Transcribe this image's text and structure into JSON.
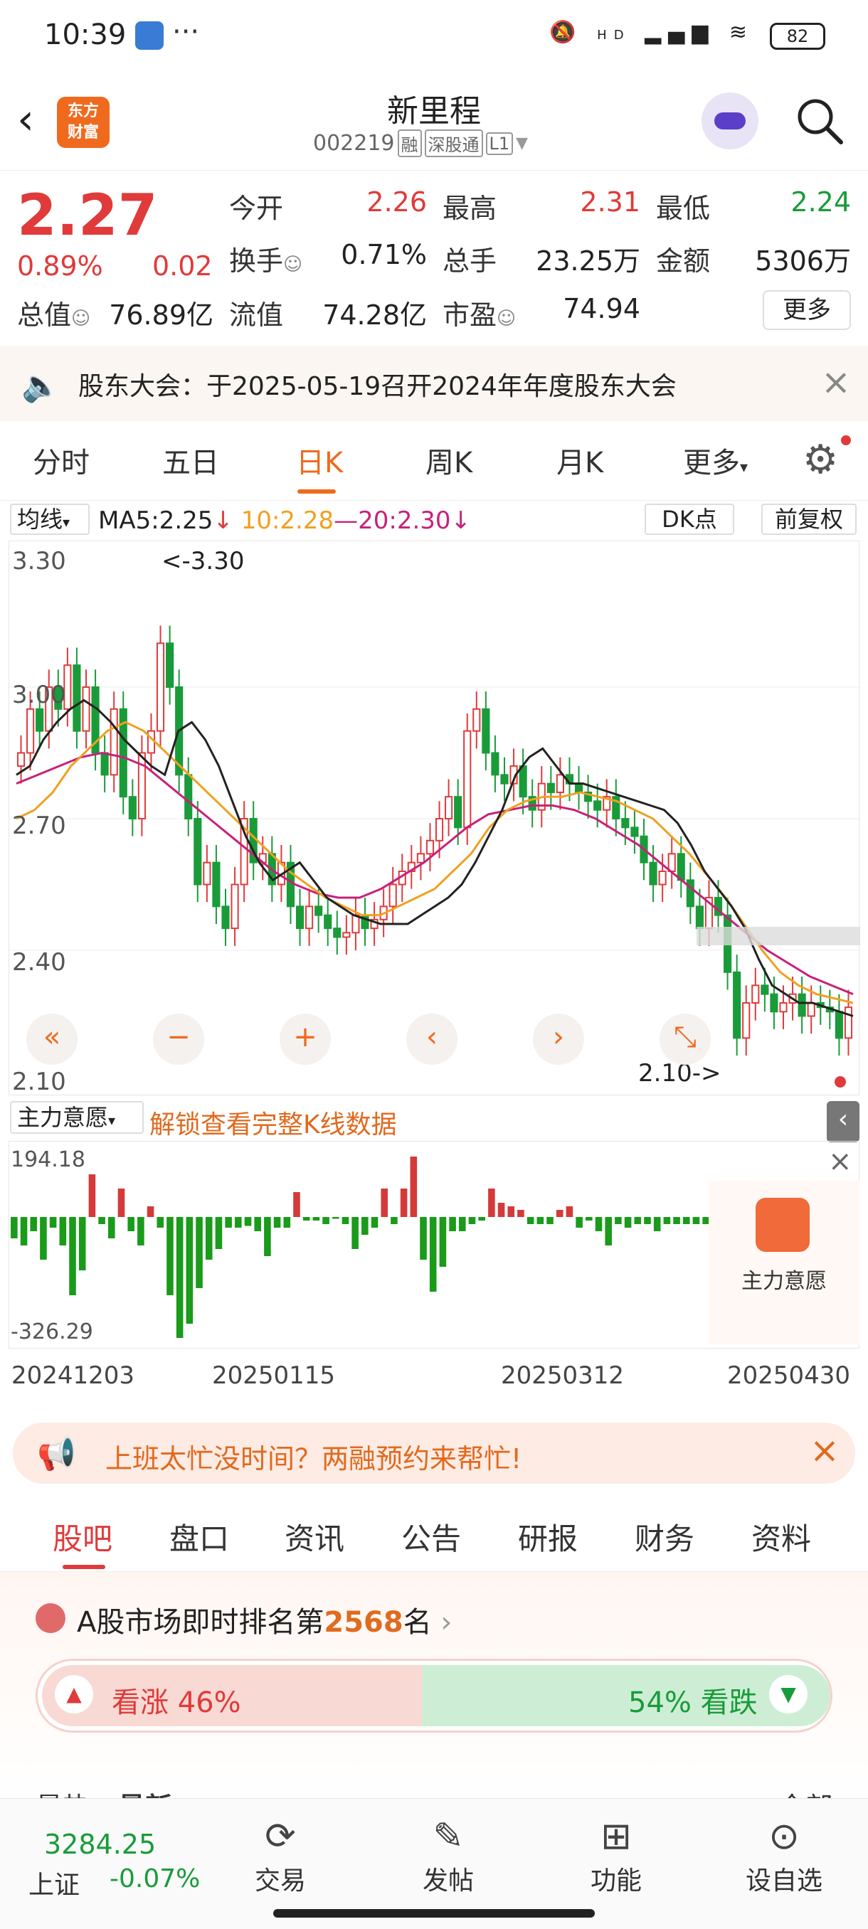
{
  "status_bar": {
    "time": "10:39",
    "extra": "···",
    "battery": "82",
    "signal_text": "HD"
  },
  "header": {
    "title": "新里程",
    "code": "002219",
    "tags": [
      "融",
      "深股通",
      "L1"
    ],
    "logo_text_1": "东方",
    "logo_text_2": "财富"
  },
  "quote": {
    "price": "2.27",
    "change_pct": "0.89%",
    "change": "0.02",
    "rows": [
      [
        {
          "label": "今开",
          "value": "2.26",
          "tone": "red"
        },
        {
          "label": "最高",
          "value": "2.31",
          "tone": "red"
        },
        {
          "label": "最低",
          "value": "2.24",
          "tone": "green"
        }
      ],
      [
        {
          "label": "换手",
          "value": "0.71%",
          "tone": "plain"
        },
        {
          "label": "总手",
          "value": "23.25万",
          "tone": "plain"
        },
        {
          "label": "金额",
          "value": "5306万",
          "tone": "plain"
        }
      ],
      [
        {
          "label": "总值",
          "value": "76.89亿",
          "tone": "plain"
        },
        {
          "label": "流值",
          "value": "74.28亿",
          "tone": "plain"
        },
        {
          "label": "市盈",
          "value": "74.94",
          "tone": "plain"
        }
      ]
    ],
    "more_label": "更多"
  },
  "notice": {
    "text": "股东大会：于2025-05-19召开2024年年度股东大会"
  },
  "period_tabs": [
    "分时",
    "五日",
    "日K",
    "周K",
    "月K",
    "更多"
  ],
  "active_period": "日K",
  "ma_row": {
    "selector": "均线",
    "ma5": "MA5:2.25",
    "ma10": "10:2.28",
    "ma20": "20:2.30",
    "dk_label": "DK点",
    "adjust_label": "前复权",
    "colors": {
      "ma5": "#222222",
      "ma10": "#f0a020",
      "ma20": "#c8207a",
      "up": "#e03a3a",
      "down": "#1a9b3a"
    }
  },
  "chart_data": {
    "type": "candlestick",
    "y_ticks": [
      "3.30",
      "3.00",
      "2.70",
      "2.40",
      "2.10"
    ],
    "ylim": [
      2.1,
      3.3
    ],
    "max_marker": "<-3.30",
    "min_marker": "2.10->",
    "x_labels": [
      "20241203",
      "20250115",
      "20250312",
      "20250430"
    ],
    "close": [
      2.85,
      2.95,
      2.9,
      3.0,
      2.95,
      3.05,
      2.9,
      3.0,
      2.85,
      2.8,
      2.95,
      2.75,
      2.7,
      2.85,
      2.9,
      3.1,
      3.0,
      2.8,
      2.7,
      2.55,
      2.6,
      2.5,
      2.45,
      2.55,
      2.7,
      2.6,
      2.62,
      2.55,
      2.6,
      2.5,
      2.45,
      2.5,
      2.48,
      2.45,
      2.43,
      2.44,
      2.48,
      2.45,
      2.47,
      2.5,
      2.55,
      2.58,
      2.6,
      2.62,
      2.65,
      2.7,
      2.75,
      2.68,
      2.9,
      2.95,
      2.85,
      2.8,
      2.78,
      2.82,
      2.75,
      2.72,
      2.78,
      2.76,
      2.8,
      2.78,
      2.76,
      2.74,
      2.72,
      2.75,
      2.7,
      2.68,
      2.66,
      2.6,
      2.55,
      2.58,
      2.62,
      2.56,
      2.5,
      2.45,
      2.52,
      2.48,
      2.35,
      2.2,
      2.28,
      2.32,
      2.3,
      2.26,
      2.28,
      2.3,
      2.25,
      2.28,
      2.27,
      2.26,
      2.2,
      2.27
    ],
    "ma5": [
      2.8,
      2.82,
      2.88,
      2.92,
      2.95,
      2.97,
      2.95,
      2.92,
      2.88,
      2.85,
      2.82,
      2.8,
      2.9,
      2.92,
      2.88,
      2.82,
      2.74,
      2.66,
      2.6,
      2.56,
      2.58,
      2.6,
      2.56,
      2.52,
      2.5,
      2.48,
      2.47,
      2.46,
      2.46,
      2.46,
      2.48,
      2.5,
      2.52,
      2.55,
      2.6,
      2.66,
      2.72,
      2.8,
      2.84,
      2.86,
      2.82,
      2.78,
      2.78,
      2.77,
      2.76,
      2.75,
      2.74,
      2.73,
      2.72,
      2.69,
      2.64,
      2.58,
      2.54,
      2.5,
      2.45,
      2.38,
      2.32,
      2.3,
      2.28,
      2.28,
      2.27,
      2.26,
      2.25
    ],
    "ma10": [
      2.7,
      2.72,
      2.76,
      2.82,
      2.86,
      2.9,
      2.92,
      2.9,
      2.86,
      2.82,
      2.78,
      2.74,
      2.7,
      2.66,
      2.62,
      2.58,
      2.55,
      2.52,
      2.5,
      2.48,
      2.48,
      2.5,
      2.52,
      2.54,
      2.58,
      2.62,
      2.68,
      2.72,
      2.74,
      2.75,
      2.75,
      2.76,
      2.75,
      2.74,
      2.72,
      2.7,
      2.66,
      2.62,
      2.57,
      2.52,
      2.46,
      2.4,
      2.35,
      2.32,
      2.3,
      2.29,
      2.28
    ],
    "ma20": [
      2.78,
      2.8,
      2.82,
      2.84,
      2.85,
      2.84,
      2.82,
      2.78,
      2.74,
      2.7,
      2.66,
      2.62,
      2.58,
      2.55,
      2.53,
      2.52,
      2.52,
      2.54,
      2.57,
      2.6,
      2.64,
      2.68,
      2.71,
      2.72,
      2.73,
      2.73,
      2.72,
      2.7,
      2.67,
      2.64,
      2.6,
      2.56,
      2.52,
      2.48,
      2.44,
      2.4,
      2.37,
      2.34,
      2.32,
      2.3
    ]
  },
  "chart_nav": [
    "«",
    "−",
    "+",
    "‹",
    "›",
    "⤡"
  ],
  "indicator": {
    "selector": "主力意愿",
    "unlock_text": "解锁查看完整K线数据",
    "max_label": "194.18",
    "min_label": "-326.29",
    "overlay_label": "主力意愿",
    "values": [
      -60,
      -80,
      -40,
      -120,
      -30,
      -80,
      -220,
      -150,
      120,
      -20,
      -60,
      80,
      -40,
      -80,
      30,
      -30,
      -220,
      -340,
      -300,
      -200,
      -120,
      -90,
      -30,
      -30,
      -25,
      -40,
      -110,
      -30,
      -30,
      70,
      -10,
      -10,
      -20,
      -5,
      -20,
      -90,
      -50,
      -30,
      80,
      -20,
      80,
      170,
      -120,
      -210,
      -140,
      -40,
      -40,
      -20,
      -10,
      80,
      40,
      30,
      20,
      -20,
      -20,
      -20,
      20,
      30,
      -30,
      -10,
      -40,
      -80,
      -20,
      -30,
      -20,
      -20,
      -40,
      -20,
      -20,
      -20,
      -20,
      -20
    ]
  },
  "banner": {
    "text": "上班太忙没时间？两融预约来帮忙!"
  },
  "content_tabs": [
    "股吧",
    "盘口",
    "资讯",
    "公告",
    "研报",
    "财务",
    "资料"
  ],
  "rank": {
    "prefix": "A股市场即时排名第",
    "number": "2568",
    "suffix": "名"
  },
  "vote": {
    "up": "看涨 46%",
    "down": "54% 看跌",
    "up_pct": 0.46
  },
  "partial_row": {
    "left": "最热",
    "mid": "最新",
    "right": "全部"
  },
  "bottom_nav": {
    "index_value": "3284.25",
    "index_name": "上证",
    "index_pct": "-0.07%",
    "items": [
      {
        "label": "交易",
        "icon": "yen-icon"
      },
      {
        "label": "发帖",
        "icon": "edit-icon"
      },
      {
        "label": "功能",
        "icon": "grid-icon"
      },
      {
        "label": "设自选",
        "icon": "more-icon"
      }
    ]
  }
}
